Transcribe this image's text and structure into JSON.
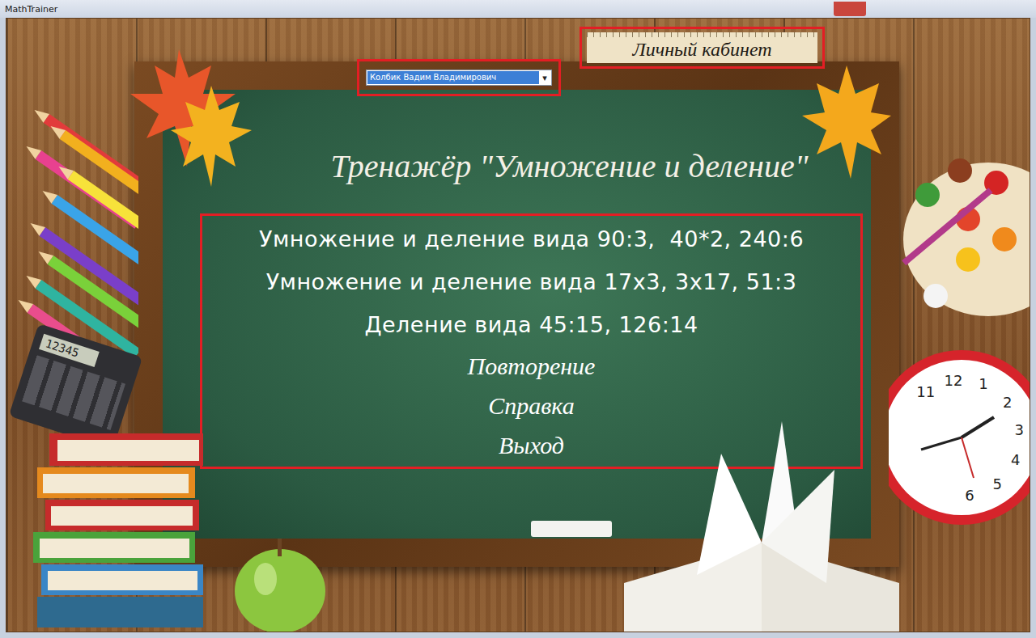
{
  "window": {
    "title": "MathTrainer"
  },
  "user_select": {
    "value": "Колбик Вадим Владимирович",
    "arrow": "▾"
  },
  "cabinet_button": {
    "label": "Личный кабинет"
  },
  "title": "Тренажёр \"Умножение и деление\"",
  "menu": [
    {
      "label": "Умножение и деление вида 90:3,  40*2, 240:6",
      "kind": "topic"
    },
    {
      "label": "Умножение и деление вида 17х3, 3х17, 51:3",
      "kind": "topic"
    },
    {
      "label": "Деление вида 45:15, 126:14",
      "kind": "topic"
    },
    {
      "label": "Повторение",
      "kind": "action"
    },
    {
      "label": "Справка",
      "kind": "action"
    },
    {
      "label": "Выход",
      "kind": "action"
    }
  ],
  "calculator": {
    "display": "12345"
  },
  "clock": {
    "numbers": [
      "11",
      "12",
      "1",
      "2",
      "3",
      "4",
      "5",
      "6"
    ]
  }
}
